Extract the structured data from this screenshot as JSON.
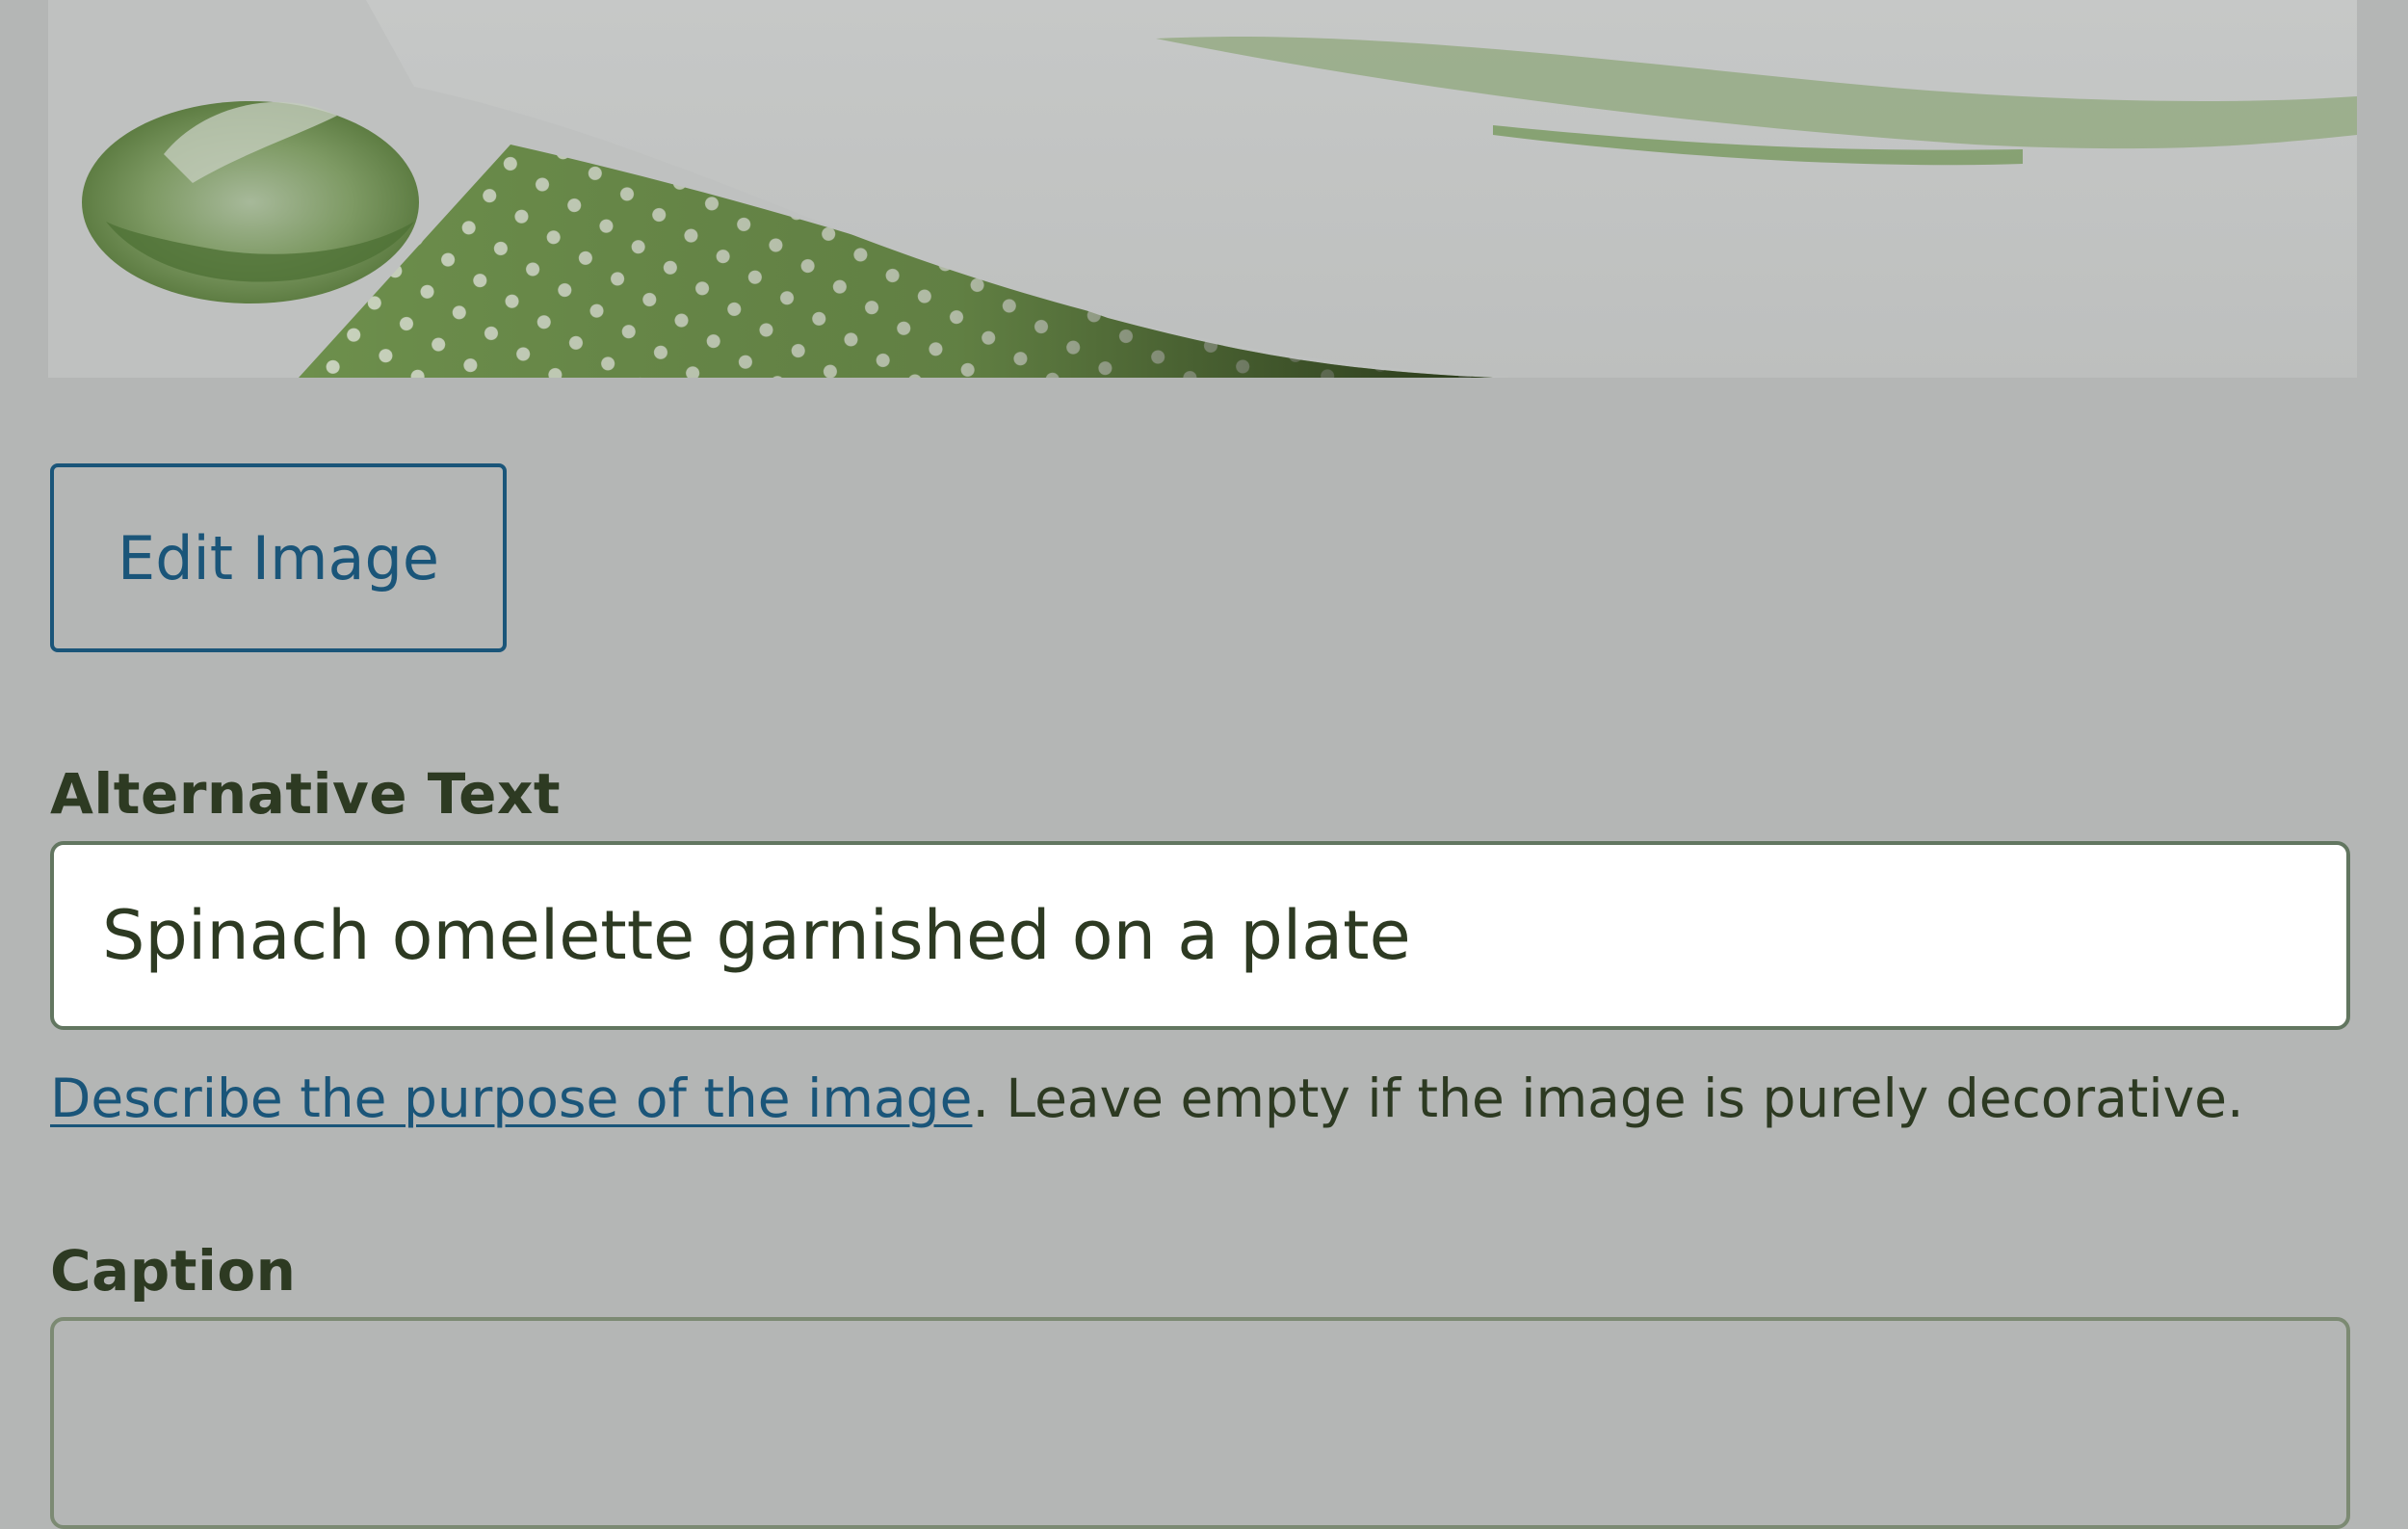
{
  "edit_button": {
    "label": "Edit Image"
  },
  "alt_text": {
    "label": "Alternative Text",
    "value": "Spinach omelette garnished on a plate",
    "help_link": "Describe the purpose of the image",
    "help_text": ". Leave empty if the image is purely decorative."
  },
  "caption": {
    "label": "Caption",
    "value": ""
  },
  "colors": {
    "overlay_background": "#b4b6b5",
    "link_and_button": "#1a5579",
    "text": "#2d3a22",
    "input_border": "#627660"
  },
  "icons": {
    "preview": "food-photo-thumbnail"
  }
}
